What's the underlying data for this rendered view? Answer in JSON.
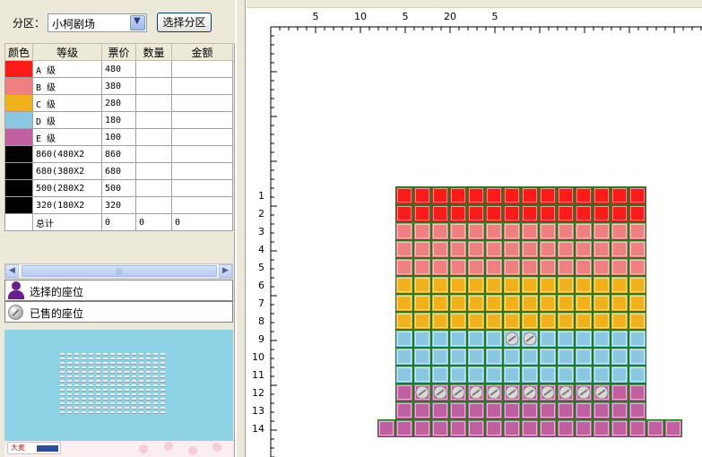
{
  "zone_panel": {
    "label": "分区：",
    "selected_zone": "小柯剧场",
    "select_button": "选择分区"
  },
  "price_table": {
    "headers": [
      "颜色",
      "等级",
      "票价",
      "数量",
      "金额"
    ],
    "rows": [
      {
        "color": "#ff1a1a",
        "level": "A 级",
        "price": "480",
        "qty": "",
        "amount": ""
      },
      {
        "color": "#f08080",
        "level": "B 级",
        "price": "380",
        "qty": "",
        "amount": ""
      },
      {
        "color": "#f0b11a",
        "level": "C 级",
        "price": "280",
        "qty": "",
        "amount": ""
      },
      {
        "color": "#8ac8e2",
        "level": "D 级",
        "price": "180",
        "qty": "",
        "amount": ""
      },
      {
        "color": "#c060a0",
        "level": "E 级",
        "price": "100",
        "qty": "",
        "amount": ""
      },
      {
        "color": "#000000",
        "level": "860(480X2",
        "price": "860",
        "qty": "",
        "amount": ""
      },
      {
        "color": "#000000",
        "level": "680(380X2",
        "price": "680",
        "qty": "",
        "amount": ""
      },
      {
        "color": "#000000",
        "level": "500(280X2",
        "price": "500",
        "qty": "",
        "amount": ""
      },
      {
        "color": "#000000",
        "level": "320(180X2",
        "price": "320",
        "qty": "",
        "amount": ""
      }
    ],
    "total": {
      "level": "总计",
      "price": "0",
      "qty": "0",
      "amount": "0"
    }
  },
  "scrollbar": {
    "left_icon": "arrow-left-icon",
    "right_icon": "arrow-right-icon",
    "thumb_grip": "|||"
  },
  "legend": {
    "selected": {
      "icon": "person-icon",
      "text": "选择的座位"
    },
    "sold": {
      "icon": "sold-seat-icon",
      "text": "已售的座位"
    }
  },
  "seat_map": {
    "ruler_top_labels": [
      "5",
      "10",
      "5",
      "20",
      "5"
    ],
    "row_labels": [
      "1",
      "2",
      "3",
      "4",
      "5",
      "6",
      "7",
      "8",
      "9",
      "10",
      "11",
      "12",
      "13",
      "14"
    ],
    "seats_per_row": 14,
    "wide_row": {
      "row": "14",
      "seats": 17
    },
    "row_levels": [
      "A",
      "A",
      "B",
      "B",
      "B",
      "C",
      "C",
      "C",
      "D",
      "D",
      "D",
      "E",
      "E",
      "E"
    ],
    "level_colors": {
      "A": "#ff1a1a",
      "B": "#f08080",
      "C": "#f0b11a",
      "D": "#8ac8e2",
      "E": "#c060a0"
    },
    "sold_seats": [
      {
        "row": "9",
        "seat": 7
      },
      {
        "row": "9",
        "seat": 8
      },
      {
        "row": "12",
        "seat": 2
      },
      {
        "row": "12",
        "seat": 3
      },
      {
        "row": "12",
        "seat": 4
      },
      {
        "row": "12",
        "seat": 5
      },
      {
        "row": "12",
        "seat": 6
      },
      {
        "row": "12",
        "seat": 7
      },
      {
        "row": "12",
        "seat": 8
      },
      {
        "row": "12",
        "seat": 9
      },
      {
        "row": "12",
        "seat": 10
      },
      {
        "row": "12",
        "seat": 11
      },
      {
        "row": "12",
        "seat": 12
      }
    ]
  },
  "minimap": {
    "rows": 14,
    "cols": 15
  },
  "bottom_logo": {
    "text": "大麦"
  }
}
